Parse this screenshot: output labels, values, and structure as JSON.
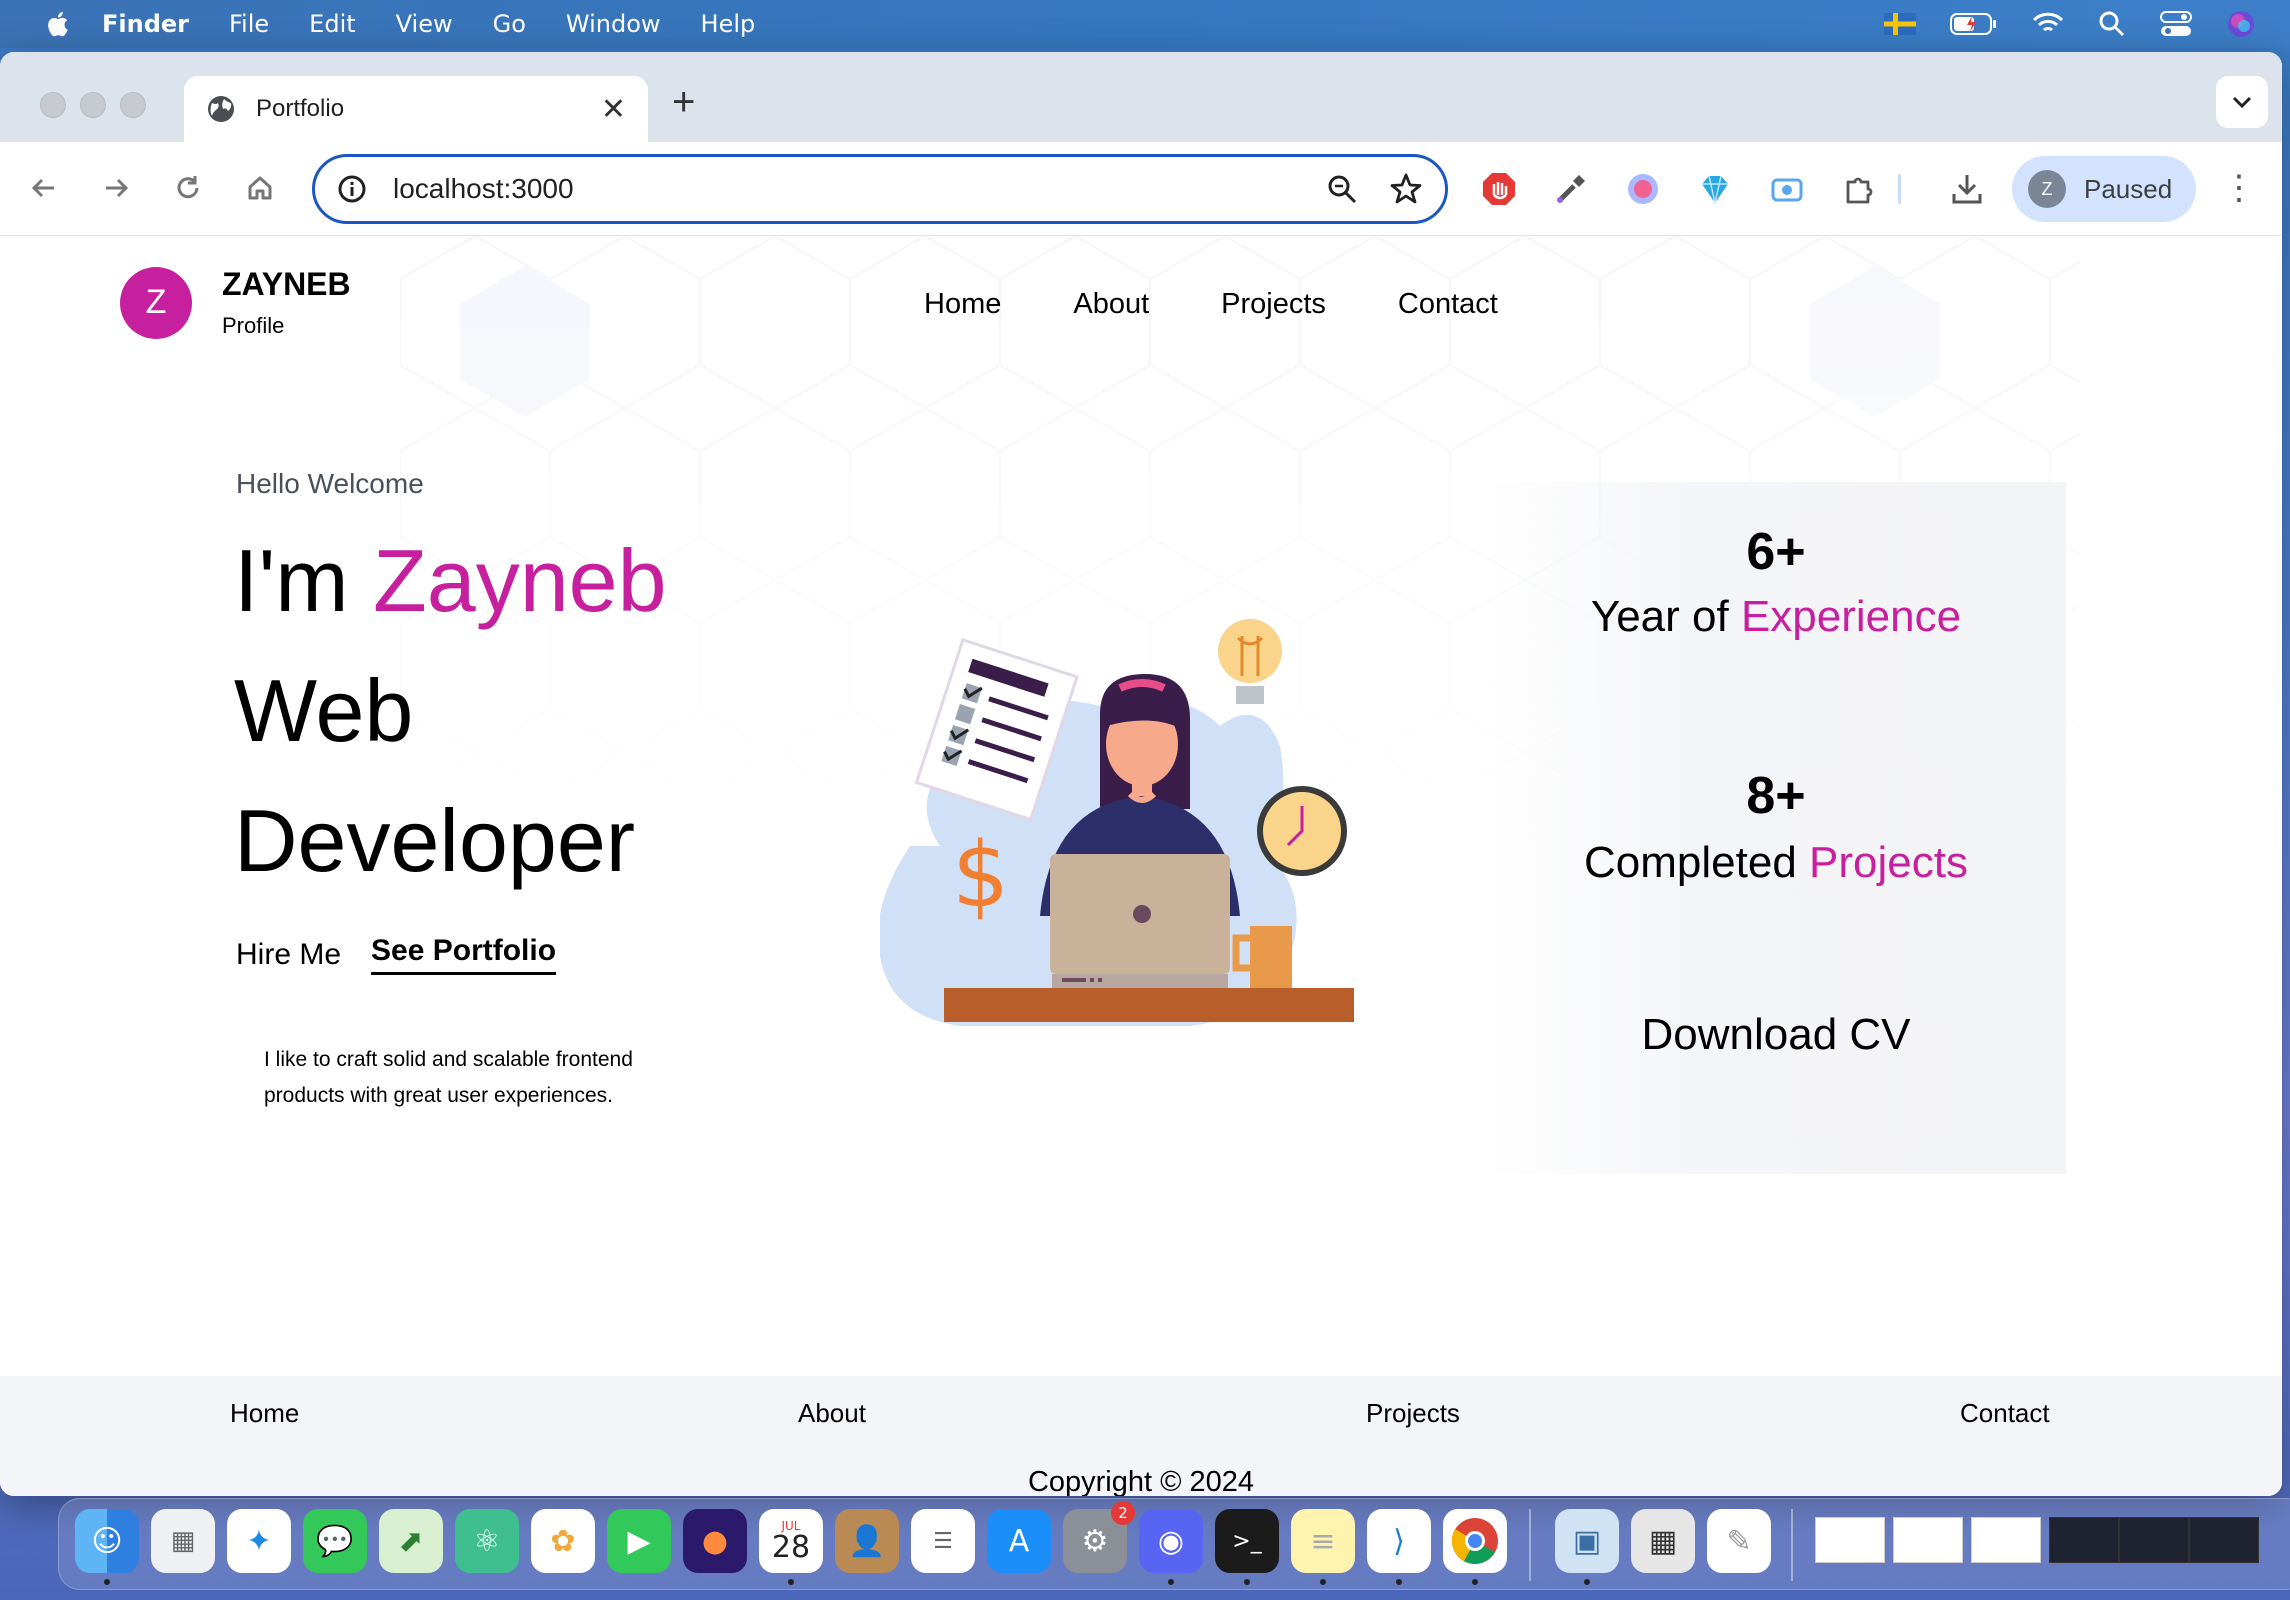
{
  "menubar": {
    "app_name": "Finder",
    "items": [
      "File",
      "Edit",
      "View",
      "Go",
      "Window",
      "Help"
    ],
    "icons": [
      "flag-sweden-icon",
      "battery-icon",
      "wifi-icon",
      "spotlight-search-icon",
      "control-center-icon",
      "siri-icon"
    ]
  },
  "browser": {
    "tab": {
      "title": "Portfolio",
      "icon": "globe-icon"
    },
    "new_tab_label": "+",
    "address": {
      "url": "localhost:3000"
    },
    "profile": {
      "initial": "Z",
      "status": "Paused"
    },
    "extensions": [
      "adblock-icon",
      "eyedropper-icon",
      "record-icon",
      "gem-icon",
      "screen-capture-icon",
      "puzzle-icon",
      "download-icon"
    ]
  },
  "site": {
    "brand": {
      "initial": "Z",
      "name": "ZAYNEB",
      "subtitle": "Profile"
    },
    "nav": [
      "Home",
      "About",
      "Projects",
      "Contact"
    ],
    "hero": {
      "greeting": "Hello Welcome",
      "line1_prefix": "I'm ",
      "line1_name": "Zayneb",
      "line2": "Web",
      "line3": "Developer",
      "hire_label": "Hire Me",
      "portfolio_label": "See Portfolio",
      "tagline": "I like to craft solid and scalable frontend products with great user experiences."
    },
    "stats": [
      {
        "value": "6+",
        "label_plain": "Year of ",
        "label_accent": "Experience"
      },
      {
        "value": "8+",
        "label_plain": "Completed ",
        "label_accent": "Projects"
      }
    ],
    "download_label": "Download CV",
    "footer": {
      "links": [
        "Home",
        "About",
        "Projects",
        "Contact"
      ],
      "copyright": "Copyright © 2024"
    },
    "colors": {
      "accent": "#c6209e",
      "footer_bg": "#f3f5f9",
      "omnibox_border": "#1a56c4"
    }
  },
  "dock": {
    "calendar": {
      "month": "JUL",
      "day": "28"
    },
    "settings_badge": "2",
    "apps": [
      "finder",
      "launchpad",
      "safari",
      "messages",
      "maps",
      "atom",
      "photos",
      "facetime",
      "firefox",
      "calendar",
      "contacts",
      "reminders",
      "app-store",
      "system-settings",
      "discord",
      "terminal",
      "notes",
      "vscode",
      "chrome",
      "preview",
      "calculator",
      "textedit"
    ]
  }
}
